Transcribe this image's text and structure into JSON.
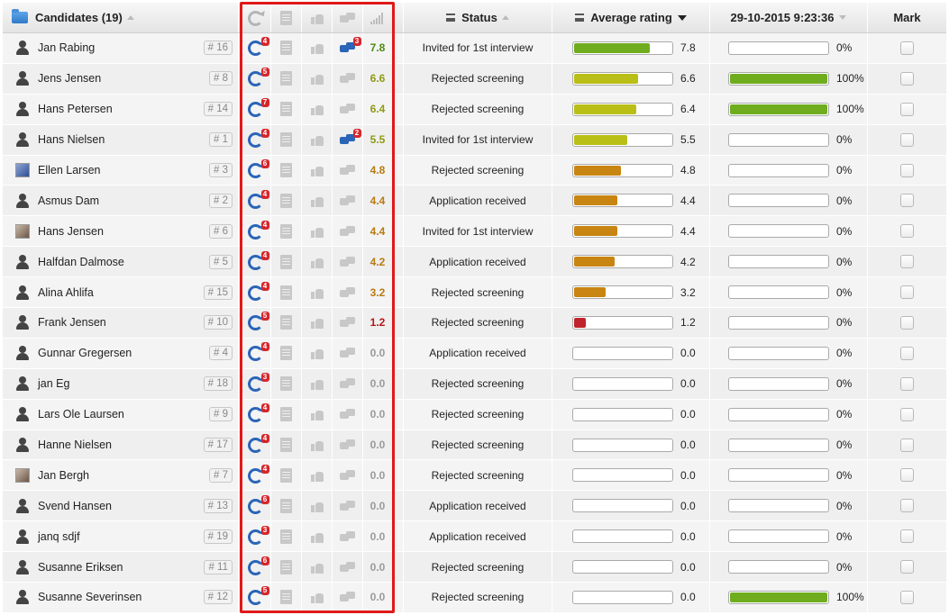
{
  "header": {
    "candidates_label": "Candidates",
    "candidates_count": "(19)",
    "status_label": "Status",
    "avg_rating_label": "Average rating",
    "date_label": "29-10-2015 9:23:36",
    "mark_label": "Mark"
  },
  "colors": {
    "green": "#6fad1f",
    "olive": "#b9bf17",
    "orange": "#c88511",
    "red": "#c0232b",
    "highlight": "#e01919"
  },
  "rows": [
    {
      "name": "Jan Rabing",
      "rank": "# 16",
      "avatar": "person",
      "refresh_badge": "4",
      "comment_badge": "3",
      "score": "7.8",
      "score_color": "green",
      "status": "Invited for 1st interview",
      "avg": 7.8,
      "avg_text": "7.8",
      "date_pct": 0,
      "date_text": "0%"
    },
    {
      "name": "Jens Jensen",
      "rank": "# 8",
      "avatar": "person",
      "refresh_badge": "5",
      "comment_badge": "",
      "score": "6.6",
      "score_color": "olive",
      "status": "Rejected screening",
      "avg": 6.6,
      "avg_text": "6.6",
      "date_pct": 100,
      "date_text": "100%"
    },
    {
      "name": "Hans Petersen",
      "rank": "# 14",
      "avatar": "person",
      "refresh_badge": "7",
      "comment_badge": "",
      "score": "6.4",
      "score_color": "olive",
      "status": "Rejected screening",
      "avg": 6.4,
      "avg_text": "6.4",
      "date_pct": 100,
      "date_text": "100%"
    },
    {
      "name": "Hans Nielsen",
      "rank": "# 1",
      "avatar": "person",
      "refresh_badge": "4",
      "comment_badge": "2",
      "score": "5.5",
      "score_color": "olive",
      "status": "Invited for 1st interview",
      "avg": 5.5,
      "avg_text": "5.5",
      "date_pct": 0,
      "date_text": "0%"
    },
    {
      "name": "Ellen Larsen",
      "rank": "# 3",
      "avatar": "photo-blue",
      "refresh_badge": "6",
      "comment_badge": "",
      "score": "4.8",
      "score_color": "orange",
      "status": "Rejected screening",
      "avg": 4.8,
      "avg_text": "4.8",
      "date_pct": 0,
      "date_text": "0%"
    },
    {
      "name": "Asmus Dam",
      "rank": "# 2",
      "avatar": "person",
      "refresh_badge": "4",
      "comment_badge": "",
      "score": "4.4",
      "score_color": "orange",
      "status": "Application received",
      "avg": 4.4,
      "avg_text": "4.4",
      "date_pct": 0,
      "date_text": "0%"
    },
    {
      "name": "Hans Jensen",
      "rank": "# 6",
      "avatar": "photo",
      "refresh_badge": "4",
      "comment_badge": "",
      "score": "4.4",
      "score_color": "orange",
      "status": "Invited for 1st interview",
      "avg": 4.4,
      "avg_text": "4.4",
      "date_pct": 0,
      "date_text": "0%"
    },
    {
      "name": "Halfdan Dalmose",
      "rank": "# 5",
      "avatar": "person",
      "refresh_badge": "4",
      "comment_badge": "",
      "score": "4.2",
      "score_color": "orange",
      "status": "Application received",
      "avg": 4.2,
      "avg_text": "4.2",
      "date_pct": 0,
      "date_text": "0%"
    },
    {
      "name": "Alina Ahlifa",
      "rank": "# 15",
      "avatar": "person",
      "refresh_badge": "4",
      "comment_badge": "",
      "score": "3.2",
      "score_color": "orange",
      "status": "Rejected screening",
      "avg": 3.2,
      "avg_text": "3.2",
      "date_pct": 0,
      "date_text": "0%"
    },
    {
      "name": "Frank Jensen",
      "rank": "# 10",
      "avatar": "person",
      "refresh_badge": "5",
      "comment_badge": "",
      "score": "1.2",
      "score_color": "red",
      "status": "Rejected screening",
      "avg": 1.2,
      "avg_text": "1.2",
      "date_pct": 0,
      "date_text": "0%"
    },
    {
      "name": "Gunnar Gregersen",
      "rank": "# 4",
      "avatar": "person",
      "refresh_badge": "4",
      "comment_badge": "",
      "score": "0.0",
      "score_color": "grey",
      "status": "Application received",
      "avg": 0,
      "avg_text": "0.0",
      "date_pct": 0,
      "date_text": "0%"
    },
    {
      "name": "jan Eg",
      "rank": "# 18",
      "avatar": "person",
      "refresh_badge": "3",
      "comment_badge": "",
      "score": "0.0",
      "score_color": "grey",
      "status": "Rejected screening",
      "avg": 0,
      "avg_text": "0.0",
      "date_pct": 0,
      "date_text": "0%"
    },
    {
      "name": "Lars Ole Laursen",
      "rank": "# 9",
      "avatar": "person",
      "refresh_badge": "4",
      "comment_badge": "",
      "score": "0.0",
      "score_color": "grey",
      "status": "Rejected screening",
      "avg": 0,
      "avg_text": "0.0",
      "date_pct": 0,
      "date_text": "0%"
    },
    {
      "name": "Hanne Nielsen",
      "rank": "# 17",
      "avatar": "person",
      "refresh_badge": "4",
      "comment_badge": "",
      "score": "0.0",
      "score_color": "grey",
      "status": "Rejected screening",
      "avg": 0,
      "avg_text": "0.0",
      "date_pct": 0,
      "date_text": "0%"
    },
    {
      "name": "Jan Bergh",
      "rank": "# 7",
      "avatar": "photo",
      "refresh_badge": "4",
      "comment_badge": "",
      "score": "0.0",
      "score_color": "grey",
      "status": "Rejected screening",
      "avg": 0,
      "avg_text": "0.0",
      "date_pct": 0,
      "date_text": "0%"
    },
    {
      "name": "Svend Hansen",
      "rank": "# 13",
      "avatar": "person",
      "refresh_badge": "6",
      "comment_badge": "",
      "score": "0.0",
      "score_color": "grey",
      "status": "Application received",
      "avg": 0,
      "avg_text": "0.0",
      "date_pct": 0,
      "date_text": "0%"
    },
    {
      "name": "janq sdjf",
      "rank": "# 19",
      "avatar": "person",
      "refresh_badge": "3",
      "comment_badge": "",
      "score": "0.0",
      "score_color": "grey",
      "status": "Application received",
      "avg": 0,
      "avg_text": "0.0",
      "date_pct": 0,
      "date_text": "0%"
    },
    {
      "name": "Susanne Eriksen",
      "rank": "# 11",
      "avatar": "person",
      "refresh_badge": "6",
      "comment_badge": "",
      "score": "0.0",
      "score_color": "grey",
      "status": "Rejected screening",
      "avg": 0,
      "avg_text": "0.0",
      "date_pct": 0,
      "date_text": "0%"
    },
    {
      "name": "Susanne Severinsen",
      "rank": "# 12",
      "avatar": "person",
      "refresh_badge": "5",
      "comment_badge": "",
      "score": "0.0",
      "score_color": "grey",
      "status": "Rejected screening",
      "avg": 0,
      "avg_text": "0.0",
      "date_pct": 100,
      "date_text": "100%"
    }
  ]
}
